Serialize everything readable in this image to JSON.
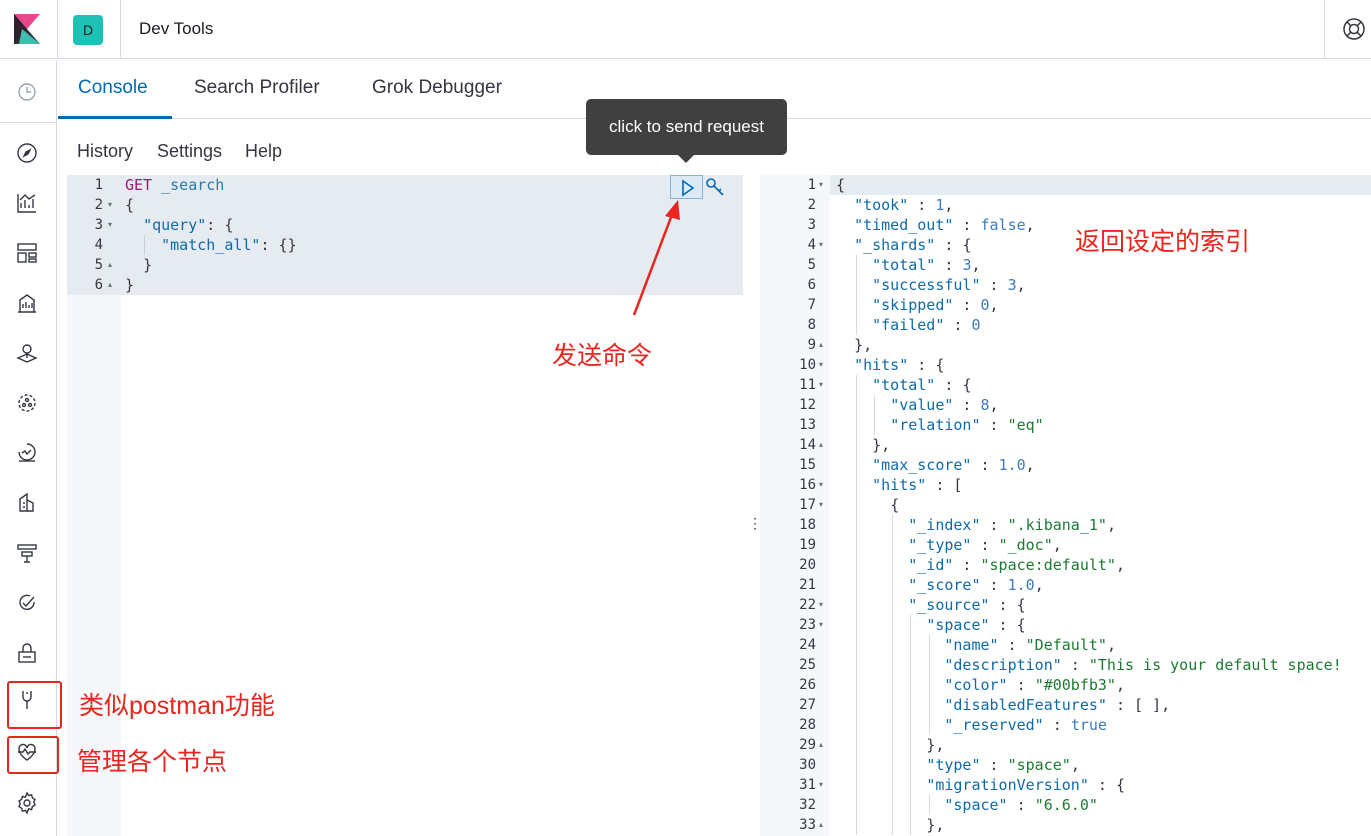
{
  "header": {
    "space_initial": "D",
    "app_title": "Dev Tools"
  },
  "tabs": [
    {
      "label": "Console",
      "active": true
    },
    {
      "label": "Search Profiler",
      "active": false
    },
    {
      "label": "Grok Debugger",
      "active": false
    }
  ],
  "console_menu": {
    "history": "History",
    "settings": "Settings",
    "help": "Help"
  },
  "tooltip": {
    "text": "click to send request"
  },
  "request_editor": {
    "lines": [
      "GET _search",
      "{",
      "  \"query\": {",
      "    \"match_all\": {}",
      "  }",
      "}"
    ]
  },
  "response_editor": {
    "lines": [
      "{",
      "  \"took\" : 1,",
      "  \"timed_out\" : false,",
      "  \"_shards\" : {",
      "    \"total\" : 3,",
      "    \"successful\" : 3,",
      "    \"skipped\" : 0,",
      "    \"failed\" : 0",
      "  },",
      "  \"hits\" : {",
      "    \"total\" : {",
      "      \"value\" : 8,",
      "      \"relation\" : \"eq\"",
      "    },",
      "    \"max_score\" : 1.0,",
      "    \"hits\" : [",
      "      {",
      "        \"_index\" : \".kibana_1\",",
      "        \"_type\" : \"_doc\",",
      "        \"_id\" : \"space:default\",",
      "        \"_score\" : 1.0,",
      "        \"_source\" : {",
      "          \"space\" : {",
      "            \"name\" : \"Default\",",
      "            \"description\" : \"This is your default space!",
      "            \"color\" : \"#00bfb3\",",
      "            \"disabledFeatures\" : [ ],",
      "            \"_reserved\" : true",
      "          },",
      "          \"type\" : \"space\",",
      "          \"migrationVersion\" : {",
      "            \"space\" : \"6.6.0\"",
      "          },"
    ]
  },
  "annotations": {
    "send_command": "发送命令",
    "return_index": "返回设定的索引",
    "postman_like": "类似postman功能",
    "manage_nodes": "管理各个节点"
  },
  "colors": {
    "accent": "#006bb4",
    "annotation_red": "#e8261f",
    "space_badge": "#20c1b5"
  }
}
